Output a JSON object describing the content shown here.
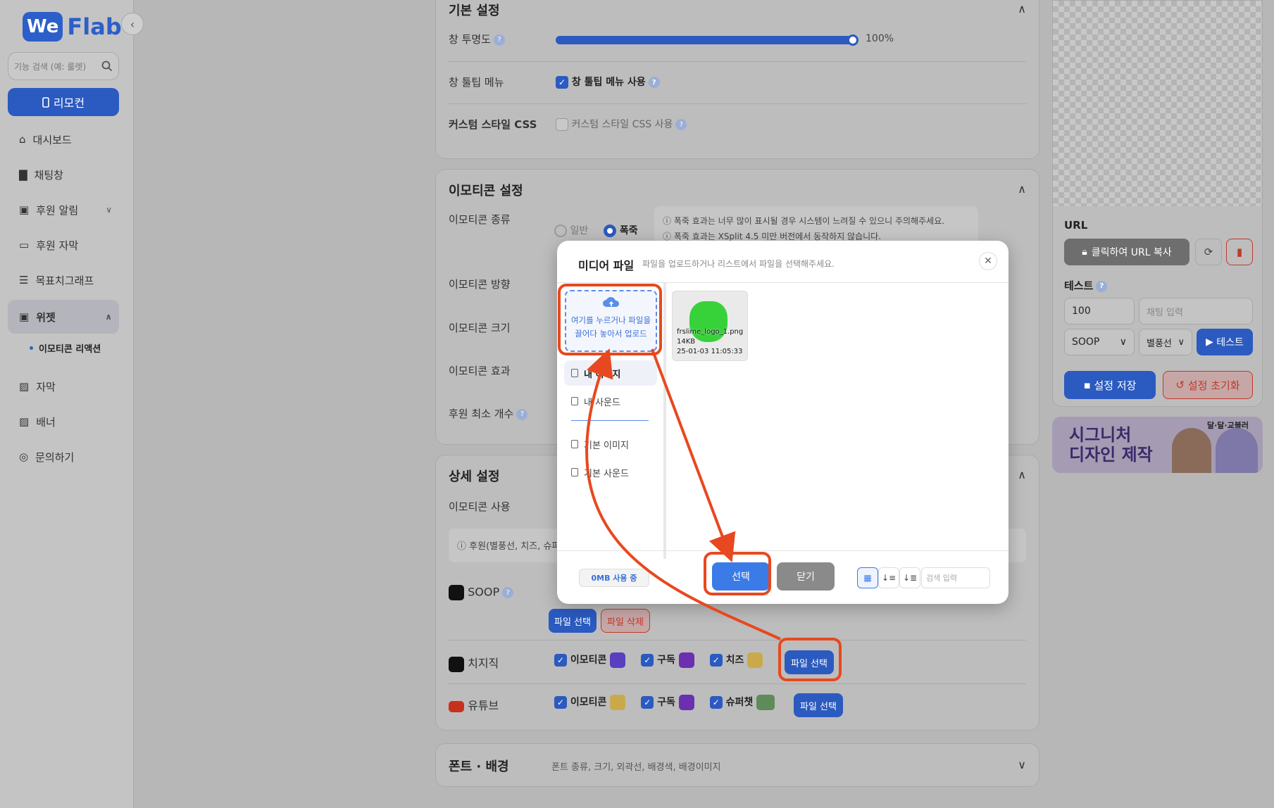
{
  "sidebar": {
    "logo_we": "We",
    "logo_flab": "Flab",
    "search_placeholder": "기능 검색 (예: 룰렛)",
    "remote_label": "리모컨",
    "items": [
      {
        "label": "대시보드"
      },
      {
        "label": "채팅창"
      },
      {
        "label": "후원 알림"
      },
      {
        "label": "후원 자막"
      },
      {
        "label": "목표치그래프"
      },
      {
        "label": "위젯"
      },
      {
        "label": "자막"
      },
      {
        "label": "배너"
      },
      {
        "label": "문의하기"
      }
    ],
    "sub_item": "이모티콘 리액션"
  },
  "basic": {
    "title": "기본 설정",
    "opacity_label": "창 투명도",
    "opacity_value": "100%",
    "opacity_level": 1.0,
    "tooltip_label": "창 툴팁 메뉴",
    "tooltip_check": "창 툴팁 메뉴 사용",
    "css_label": "커스텀 스타일 CSS",
    "css_check": "커스텀 스타일 CSS 사용"
  },
  "emoticon": {
    "title": "이모티콘 설정",
    "type_label": "이모티콘 종류",
    "type_opt1": "일반",
    "type_opt2": "폭죽",
    "notice1": "폭죽 효과는 너무 많이 표시될 경우 시스템이 느려질 수 있으니 주의해주세요.",
    "notice2": "폭죽 효과는 XSplit 4.5 미만 버전에서 동작하지 않습니다.",
    "direction_label": "이모티콘 방향",
    "size_label": "이모티콘 크기",
    "effect_label": "이모티콘 효과",
    "min_label": "후원 최소 개수"
  },
  "detail": {
    "title": "상세 설정",
    "use_label": "이모티콘 사용",
    "info": "후원(별풍선, 치즈, 슈퍼",
    "soop": "SOOP",
    "file_select": "파일 선택",
    "file_delete": "파일 삭제",
    "chzzk": "치지직",
    "youtube": "유튜브",
    "emoticon": "이모티콘",
    "subscribe": "구독",
    "cheese": "치즈",
    "superchat": "슈퍼챗"
  },
  "font": {
    "title": "폰트 · 배경",
    "desc": "폰트 종류, 크기, 외곽선, 배경색, 배경이미지"
  },
  "right": {
    "url_label": "URL",
    "copy_url": "클릭하여 URL 복사",
    "test_label": "테스트",
    "test_value": "100",
    "chat_placeholder": "채팅 입력",
    "platform": "SOOP",
    "type": "별풍선",
    "test_btn": "테스트",
    "save": "설정 저장",
    "reset": "설정 초기화",
    "banner_line1": "시그니처",
    "banner_line2": "디자인 제작",
    "banner_brand": "달·달·교블러"
  },
  "modal": {
    "title": "미디어 파일",
    "subtitle": "파일을 업로드하거나 리스트에서 파일을 선택해주세요.",
    "upload_line1": "여기를 누르거나 파일을",
    "upload_line2": "끌어다 놓아서 업로드",
    "tabs": [
      "내 이미지",
      "내 사운드",
      "기본 이미지",
      "기본 사운드"
    ],
    "file_name": "frslime_logo_1.png",
    "file_size": "14KB",
    "file_date": "25-01-03 11:05:33",
    "usage": "0MB 사용 중",
    "select": "선택",
    "close": "닫기",
    "search_placeholder": "검색 입력"
  },
  "colors": {
    "accent": "#2b5ac0",
    "highlight": "#e8481f",
    "danger": "#c0392b"
  }
}
